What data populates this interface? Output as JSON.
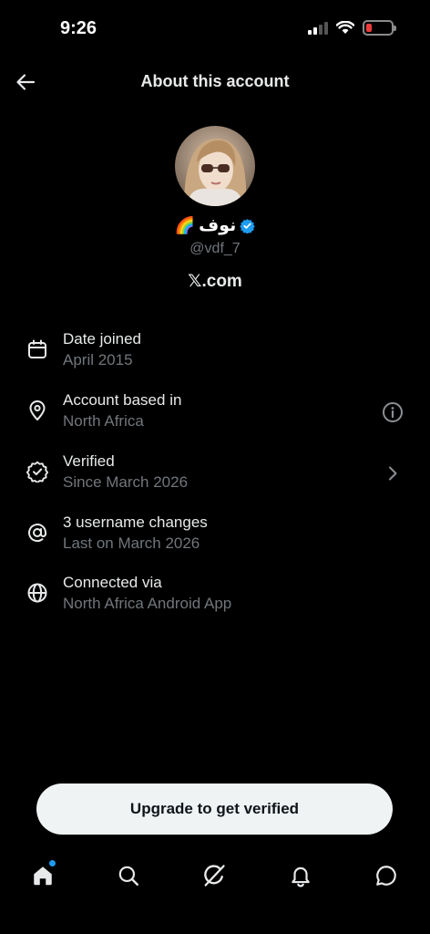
{
  "status_bar": {
    "time": "9:26"
  },
  "header": {
    "title": "About this account"
  },
  "profile": {
    "display_name": "نوف",
    "emoji": "🌈",
    "handle": "@vdf_7",
    "site_glyph": "𝕏",
    "site_rest": ".com"
  },
  "rows": [
    {
      "title": "Date joined",
      "subtitle": "April 2015",
      "icon": "calendar-icon"
    },
    {
      "title": "Account based in",
      "subtitle": "North Africa",
      "icon": "location-pin-icon",
      "trailing": "info-icon"
    },
    {
      "title": "Verified",
      "subtitle": "Since March 2026",
      "icon": "verified-badge-icon",
      "trailing": "chevron-right-icon"
    },
    {
      "title": "3 username changes",
      "subtitle": "Last on March 2026",
      "icon": "at-sign-icon"
    },
    {
      "title": "Connected via",
      "subtitle": "North Africa Android App",
      "icon": "globe-icon"
    }
  ],
  "upgrade_button": {
    "label": "Upgrade to get verified"
  },
  "nav": [
    "home-icon",
    "search-icon",
    "grok-icon",
    "bell-icon",
    "messages-icon"
  ],
  "colors": {
    "accent": "#1d9bf0",
    "muted": "#71767b",
    "text": "#e7e9ea",
    "background": "#000000",
    "battery_low": "#eb3b3b"
  }
}
